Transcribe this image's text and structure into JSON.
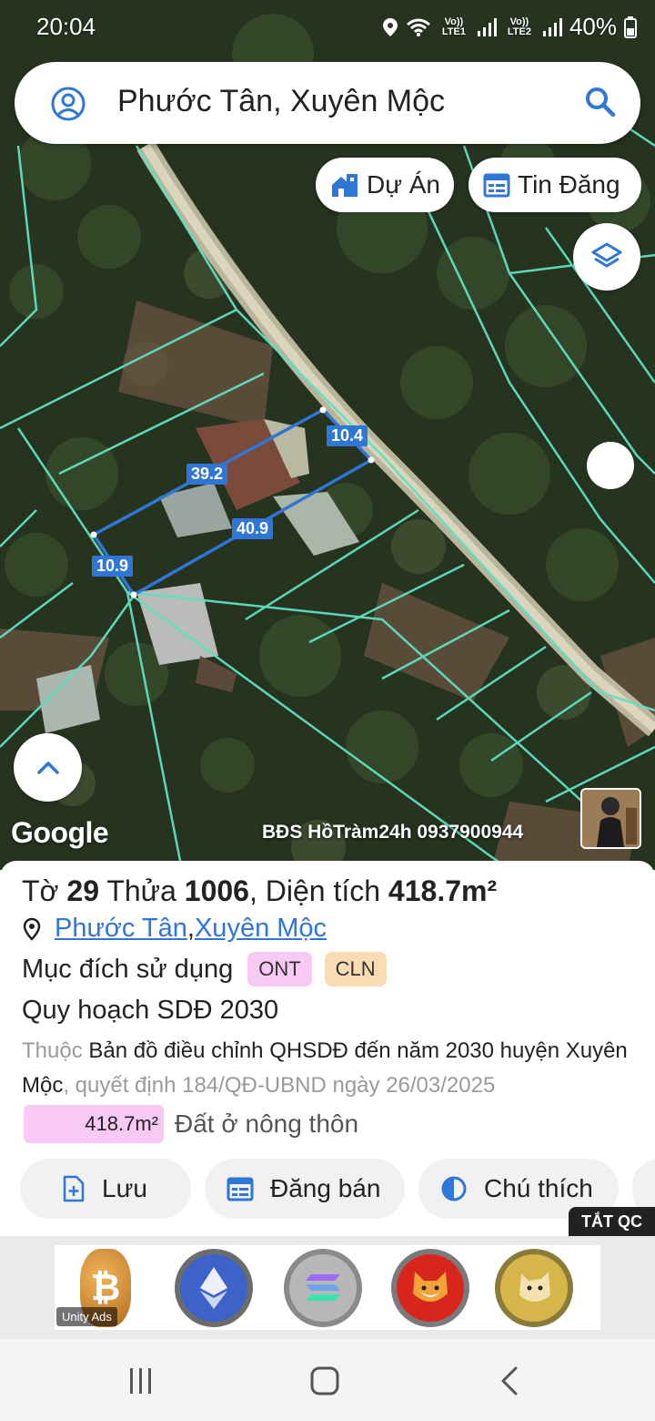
{
  "status_bar": {
    "time": "20:04",
    "sim1": "Vo)) LTE1",
    "sim2": "Vo)) LTE2",
    "battery": "40%"
  },
  "search": {
    "text": "Phước Tân, Xuyên Mộc"
  },
  "chips": {
    "projects": "Dự Án",
    "listings": "Tin Đăng"
  },
  "map": {
    "dimensions": [
      "39.2",
      "10.4",
      "40.9",
      "10.9"
    ],
    "google_logo": "Google",
    "watermark": "BĐS HồTràm24h 0937900944",
    "parcel_color": "#2f76d6",
    "boundary_color": "#5fe0c2"
  },
  "parcel": {
    "sheet_prefix": "Tờ ",
    "sheet_no": "29",
    "plot_prefix": " Thửa ",
    "plot_no": "1006",
    "area_prefix": ", Diện tích ",
    "area": "418.7m²",
    "commune": "Phước Tân",
    "separator": ", ",
    "district": "Xuyên Mộc",
    "usage_label": "Mục đích sử dụng",
    "usage_codes": [
      "ONT",
      "CLN"
    ],
    "plan_title": "Quy hoạch SDĐ 2030",
    "plan_prefix": "Thuộc",
    "plan_name": "Bản đồ điều chỉnh QHSDĐ đến năm 2030 huyện Xuyên Mộc",
    "plan_decision": ", quyết định 184/QĐ-UBND ngày 26/03/2025",
    "area_value": "418.7m²",
    "area_type": "Đất ở nông thôn"
  },
  "actions": {
    "save": "Lưu",
    "post": "Đăng bán",
    "legend": "Chú thích"
  },
  "ad": {
    "close_label": "TẮT QC",
    "tag": "Unity Ads"
  }
}
